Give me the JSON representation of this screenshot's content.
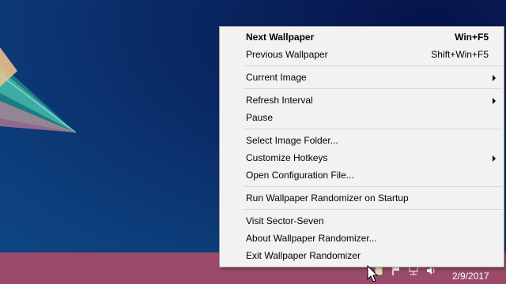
{
  "menu": {
    "next": {
      "label": "Next Wallpaper",
      "shortcut": "Win+F5"
    },
    "previous": {
      "label": "Previous Wallpaper",
      "shortcut": "Shift+Win+F5"
    },
    "current_image": {
      "label": "Current Image"
    },
    "refresh_interval": {
      "label": "Refresh Interval"
    },
    "pause": {
      "label": "Pause"
    },
    "select_folder": {
      "label": "Select Image Folder..."
    },
    "customize_hotkeys": {
      "label": "Customize Hotkeys"
    },
    "open_config": {
      "label": "Open Configuration File..."
    },
    "run_on_startup": {
      "label": "Run Wallpaper Randomizer on Startup"
    },
    "visit_site": {
      "label": "Visit Sector-Seven"
    },
    "about": {
      "label": "About Wallpaper Randomizer..."
    },
    "exit": {
      "label": "Exit Wallpaper Randomizer"
    }
  },
  "taskbar": {
    "date": "2/9/2017",
    "tray_icons": [
      "wallpaper-randomizer-icon",
      "flag-icon",
      "network-icon",
      "volume-icon"
    ]
  },
  "colors": {
    "taskbar": "#9b4a6a",
    "menu_background": "#f2f2f2",
    "desktop": "#0a2a66"
  }
}
